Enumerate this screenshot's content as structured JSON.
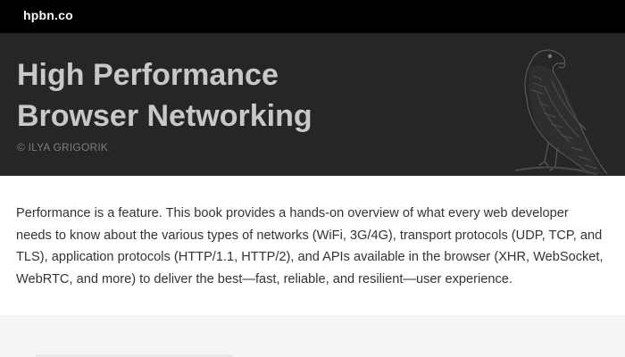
{
  "header": {
    "site_name": "hpbn.co"
  },
  "hero": {
    "title_line1": "High Performance",
    "title_line2": "Browser Networking",
    "author": "© ILYA GRIGORIK",
    "image_icon": "hawk-illustration-icon"
  },
  "intro": {
    "text": "Performance is a feature. This book provides a hands-on overview of what every web developer needs to know about the various types of networks (WiFi, 3G/4G), transport protocols (UDP, TCP, and TLS), application protocols (HTTP/1.1, HTTP/2), and APIs available in the browser (XHR, WebSocket, WebRTC, and more) to deliver the best—fast, reliable, and resilient—user experience."
  },
  "colors": {
    "topbar": "#000000",
    "hero_bg": "#262626",
    "title": "#c8c8c8",
    "author": "#7d7d7d",
    "body_text": "#333333"
  }
}
